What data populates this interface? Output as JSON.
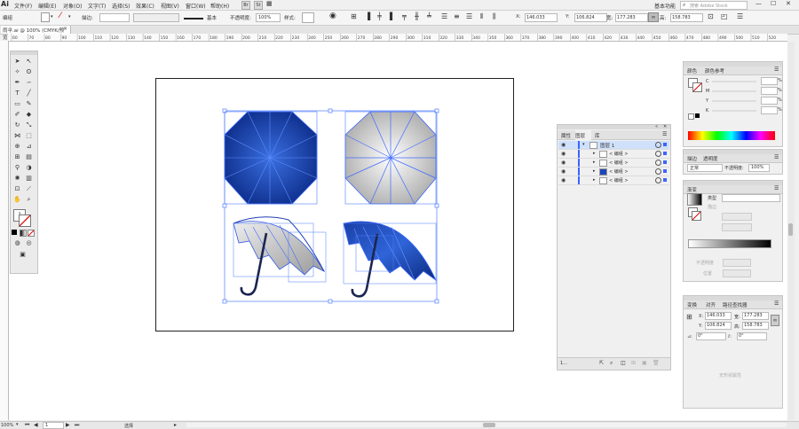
{
  "app": {
    "logo": "Ai"
  },
  "menu": [
    "文件(F)",
    "编辑(E)",
    "对象(O)",
    "文字(T)",
    "选择(S)",
    "效果(C)",
    "视图(V)",
    "窗口(W)",
    "帮助(H)"
  ],
  "workspace": {
    "label": "基本功能",
    "search_placeholder": "搜索 Adobe Stock"
  },
  "control": {
    "selection_label": "编组",
    "stroke_label": "描边:",
    "stroke_style": "基本",
    "opacity_label": "不透明度:",
    "opacity_value": "100%",
    "style_label": "样式:",
    "x_label": "X:",
    "x_value": "146.033",
    "y_label": "Y:",
    "y_value": "106.824",
    "w_label": "宽:",
    "w_value": "177.283",
    "h_label": "高:",
    "h_value": "158.783"
  },
  "document_tab": {
    "title": "雨伞.ai @ 100% (CMYK/预览)",
    "close": "×"
  },
  "ruler": [
    "60",
    "70",
    "80",
    "90",
    "100",
    "110",
    "120",
    "130",
    "140",
    "150",
    "160",
    "170",
    "180",
    "190",
    "200",
    "210",
    "220",
    "230",
    "240",
    "250",
    "260",
    "270",
    "280",
    "290",
    "300",
    "310",
    "320",
    "330",
    "340",
    "350",
    "360",
    "370",
    "380",
    "390",
    "400",
    "410",
    "420",
    "430",
    "440",
    "450",
    "460",
    "470",
    "480",
    "490",
    "500",
    "510",
    "520"
  ],
  "layers_panel": {
    "tabs": [
      "属性",
      "图层",
      "库"
    ],
    "layer_name": "图层 1",
    "rows": [
      "< 编组 >",
      "< 编组 >",
      "< 编组 >",
      "< 编组 >"
    ],
    "footer": "1..."
  },
  "color_panel": {
    "tabs": [
      "颜色",
      "颜色参考"
    ],
    "channels": [
      "C",
      "M",
      "Y",
      "K"
    ],
    "unit": "%"
  },
  "transparency_panel": {
    "tabs": [
      "描边",
      "透明度"
    ],
    "mode": "正常",
    "opacity_label": "不透明度:",
    "opacity_value": "100%"
  },
  "gradient_panel": {
    "title": "渐变",
    "type_label": "类型",
    "stroke_label": "描边",
    "opacity_label": "不透明度",
    "location_label": "位置"
  },
  "transform_panel": {
    "tabs": [
      "变换",
      "对齐",
      "路径查找器"
    ],
    "x_label": "X:",
    "x_value": "146.033",
    "y_label": "Y:",
    "y_value": "106.824",
    "w_label": "宽:",
    "w_value": "177.283",
    "h_label": "高:",
    "h_value": "158.783",
    "angle_value": "0°",
    "shear_value": "0°",
    "empty_text": "无形状属性"
  },
  "status": {
    "zoom": "100%",
    "page": "1",
    "tool": "选择"
  }
}
